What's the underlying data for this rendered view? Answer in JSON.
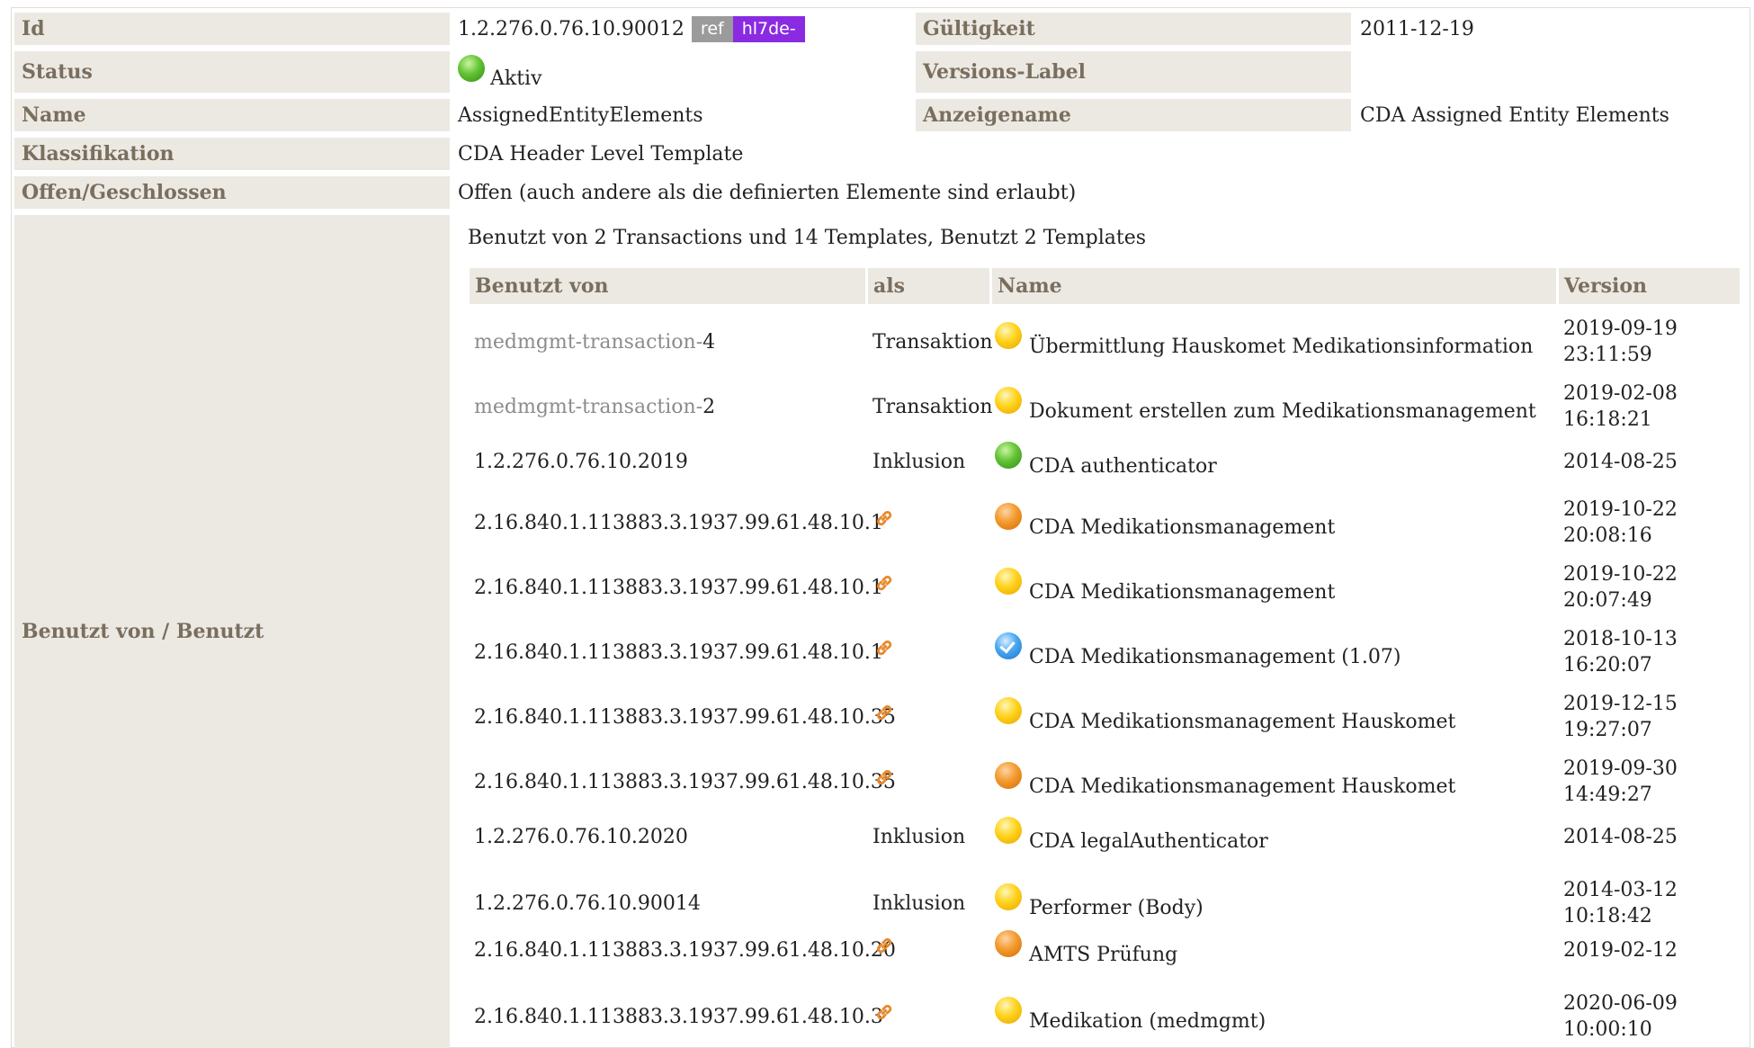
{
  "props": {
    "id": {
      "label": "Id",
      "value": "1.2.276.0.76.10.90012",
      "ref_badge": "ref",
      "prefix_badge": "hl7de-"
    },
    "validity": {
      "label": "Gültigkeit",
      "value": "2011-12-19"
    },
    "status": {
      "label": "Status",
      "value": "Aktiv",
      "status_color": "green"
    },
    "version_label": {
      "label": "Versions-Label",
      "value": ""
    },
    "name": {
      "label": "Name",
      "value": "AssignedEntityElements"
    },
    "display_name": {
      "label": "Anzeigename",
      "value": "CDA Assigned Entity Elements"
    },
    "classification": {
      "label": "Klassifikation",
      "value": "CDA Header Level Template"
    },
    "open_closed": {
      "label": "Offen/Geschlossen",
      "value": "Offen (auch andere als die definierten Elemente sind erlaubt)"
    },
    "used_by": {
      "label": "Benutzt von / Benutzt"
    }
  },
  "usage": {
    "summary": "Benutzt von 2 Transactions und 14 Templates, Benutzt 2 Templates",
    "headers": {
      "used_by": "Benutzt von",
      "as": "als",
      "name": "Name",
      "version": "Version"
    },
    "rows": [
      {
        "prefix": "medmgmt-transaction-",
        "id": "4",
        "as": "Transaktion",
        "icon": "link-icon",
        "status": "yellow",
        "name": "Übermittlung Hauskomet Medikationsinformation",
        "date": "2019-09-19",
        "time": "23:11:59"
      },
      {
        "prefix": "medmgmt-transaction-",
        "id": "2",
        "as": "Transaktion",
        "icon": "",
        "status": "yellow",
        "name": "Dokument erstellen zum Medikationsmanagement",
        "date": "2019-02-08",
        "time": "16:18:21"
      },
      {
        "prefix": "",
        "id": "1.2.276.0.76.10.2019",
        "as": "Inklusion",
        "icon": "",
        "status": "green",
        "name": "CDA authenticator",
        "date": "2014-08-25",
        "time": ""
      },
      {
        "prefix": "",
        "id": "2.16.840.1.113883.3.1937.99.61.48.10.1",
        "as": "",
        "icon": "link-icon",
        "status": "orange",
        "name": "CDA Medikationsmanagement",
        "date": "2019-10-22",
        "time": "20:08:16"
      },
      {
        "prefix": "",
        "id": "2.16.840.1.113883.3.1937.99.61.48.10.1",
        "as": "",
        "icon": "link-icon",
        "status": "yellow",
        "name": "CDA Medikationsmanagement",
        "date": "2019-10-22",
        "time": "20:07:49"
      },
      {
        "prefix": "",
        "id": "2.16.840.1.113883.3.1937.99.61.48.10.1",
        "as": "",
        "icon": "link-icon",
        "status": "blue",
        "name": "CDA Medikationsmanagement (1.07)",
        "date": "2018-10-13",
        "time": "16:20:07"
      },
      {
        "prefix": "",
        "id": "2.16.840.1.113883.3.1937.99.61.48.10.35",
        "as": "",
        "icon": "link-icon",
        "status": "yellow",
        "name": "CDA Medikationsmanagement Hauskomet",
        "date": "2019-12-15",
        "time": "19:27:07"
      },
      {
        "prefix": "",
        "id": "2.16.840.1.113883.3.1937.99.61.48.10.35",
        "as": "",
        "icon": "link-icon",
        "status": "orange",
        "name": "CDA Medikationsmanagement Hauskomet",
        "date": "2019-09-30",
        "time": "14:49:27"
      },
      {
        "prefix": "",
        "id": "1.2.276.0.76.10.2020",
        "as": "Inklusion",
        "icon": "",
        "status": "yellow",
        "name": "CDA legalAuthenticator",
        "date": "2014-08-25",
        "time": ""
      },
      {
        "prefix": "",
        "id": "1.2.276.0.76.10.90014",
        "as": "Inklusion",
        "icon": "",
        "status": "yellow",
        "name": "Performer (Body)",
        "date": "2014-03-12",
        "time": "10:18:42"
      },
      {
        "prefix": "",
        "id": "2.16.840.1.113883.3.1937.99.61.48.10.20",
        "as": "",
        "icon": "link-icon",
        "status": "orange",
        "name": "AMTS Prüfung",
        "date": "2019-02-12",
        "time": ""
      },
      {
        "prefix": "",
        "id": "2.16.840.1.113883.3.1937.99.61.48.10.3",
        "as": "",
        "icon": "link-icon",
        "status": "yellow",
        "name": "Medikation (medmgmt)",
        "date": "2020-06-09",
        "time": "10:00:10"
      }
    ]
  },
  "colors": {
    "label_bg": "#ece9e3",
    "label_text": "#7a6e5e",
    "ref_badge": "#9b9b9b",
    "prefix_badge": "#8a2be2",
    "link_icon": "#e8892b"
  }
}
